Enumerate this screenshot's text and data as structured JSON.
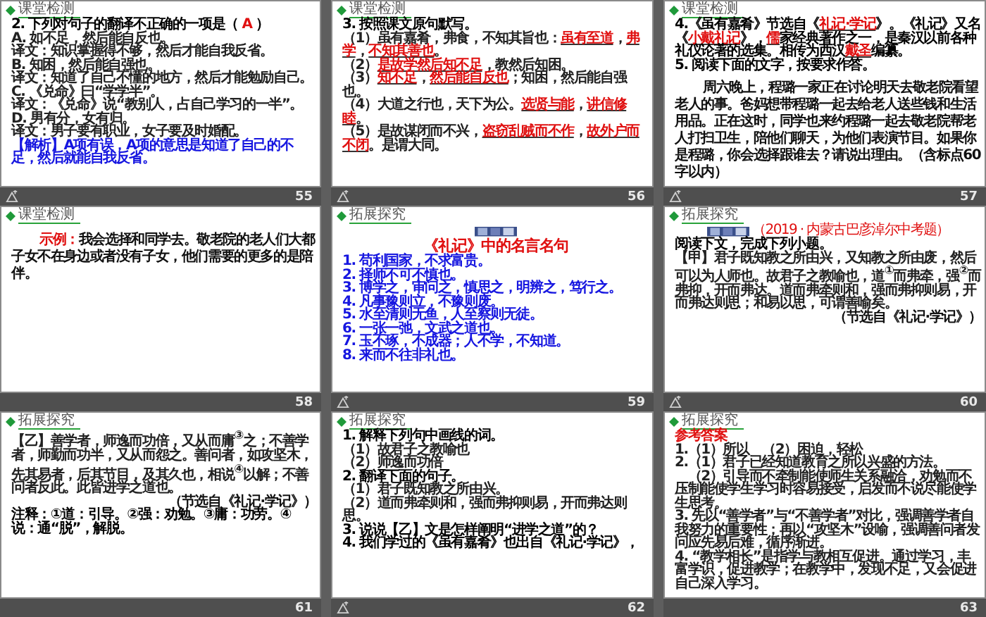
{
  "slides": [
    {
      "number": "55",
      "animated": true,
      "section": "课堂检测",
      "body": [
        {
          "kind": "question",
          "segments": [
            {
              "kind": "text",
              "text": "2. 下列对句子的翻译不正确的一项是（ "
            },
            {
              "kind": "answer",
              "text": "A"
            },
            {
              "kind": "text",
              "text": " ）"
            }
          ]
        },
        {
          "kind": "body",
          "text": "A. 如不足，然后能自反也。"
        },
        {
          "kind": "body",
          "text": "译文：知识掌握得不够，然后才能自我反省。"
        },
        {
          "kind": "body",
          "text": "B. 知困，然后能自强也。"
        },
        {
          "kind": "body",
          "text": "译文：知道了自己不懂的地方，然后才能勉励自己。"
        },
        {
          "kind": "body",
          "text": "C. 《兑命》曰“学学半”。"
        },
        {
          "kind": "body",
          "text": "译文：《兑命》说“教别人，占自己学习的一半”。"
        },
        {
          "kind": "body",
          "text": "D. 男有分，女有归。"
        },
        {
          "kind": "body",
          "text": "译文：男子要有职业，女子要及时婚配。"
        },
        {
          "kind": "blue",
          "text": "【解析】A项有误，A项的意思是知道了自己的不足，然后就能自我反省。"
        }
      ]
    },
    {
      "number": "56",
      "animated": true,
      "section": "课堂检测",
      "body": [
        {
          "kind": "question",
          "text": "3. 按照课文原句默写。"
        },
        {
          "kind": "body",
          "segments": [
            {
              "kind": "text",
              "text": "（1）虽有嘉肴，弗食，不知其旨也："
            },
            {
              "kind": "blank",
              "text": "虽有至道"
            },
            {
              "kind": "text",
              "text": "，"
            },
            {
              "kind": "blank",
              "text": "弗学"
            },
            {
              "kind": "text",
              "text": "，"
            },
            {
              "kind": "blank",
              "text": "不知其善也"
            },
            {
              "kind": "text",
              "text": "。"
            }
          ]
        },
        {
          "kind": "body",
          "segments": [
            {
              "kind": "text",
              "text": "（2）"
            },
            {
              "kind": "blank",
              "text": "是故学然后知不足"
            },
            {
              "kind": "text",
              "text": "，教然后知困。"
            }
          ]
        },
        {
          "kind": "body",
          "segments": [
            {
              "kind": "text",
              "text": "（3）"
            },
            {
              "kind": "blank",
              "text": "知不足"
            },
            {
              "kind": "text",
              "text": "，"
            },
            {
              "kind": "blank",
              "text": "然后能自反也"
            },
            {
              "kind": "text",
              "text": "；知困，然后能自强也。"
            }
          ]
        },
        {
          "kind": "body",
          "segments": [
            {
              "kind": "text",
              "text": "（4）大道之行也，天下为公。"
            },
            {
              "kind": "blank",
              "text": "选贤与能"
            },
            {
              "kind": "text",
              "text": "，"
            },
            {
              "kind": "blank",
              "text": "讲信修睦"
            },
            {
              "kind": "text",
              "text": "。"
            }
          ]
        },
        {
          "kind": "body",
          "segments": [
            {
              "kind": "text",
              "text": "（5）是故谋闭而不兴，"
            },
            {
              "kind": "blank",
              "text": "盗窃乱贼而不作"
            },
            {
              "kind": "text",
              "text": "，"
            },
            {
              "kind": "blank",
              "text": "故外户而不闭"
            },
            {
              "kind": "text",
              "text": "。是谓大同。"
            }
          ]
        }
      ]
    },
    {
      "number": "57",
      "animated": true,
      "section": "课堂检测",
      "body": [
        {
          "kind": "question",
          "segments": [
            {
              "kind": "text",
              "text": "4.《虽有嘉肴》节选自《"
            },
            {
              "kind": "blank",
              "text": "礼记·学记"
            },
            {
              "kind": "text",
              "text": "》。《礼记》又名《"
            },
            {
              "kind": "blank",
              "text": "小戴礼记"
            },
            {
              "kind": "text",
              "text": "》，"
            },
            {
              "kind": "blank",
              "text": "儒"
            },
            {
              "kind": "text",
              "text": "家经典著作之一，是秦汉以前各种礼仪论著的选集。相传为西汉"
            },
            {
              "kind": "blank",
              "text": "戴圣"
            },
            {
              "kind": "text",
              "text": "编纂。"
            }
          ]
        },
        {
          "kind": "question",
          "text": "5. 阅读下面的文字，按要求作答。"
        },
        {
          "kind": "indent",
          "text": "周六晚上，程璐一家正在讨论明天去敬老院看望老人的事。爸妈想带程璐一起去给老人送些钱和生活用品。正在这时，同学也来约程璐一起去敬老院帮老人打扫卫生，陪他们聊天，为他们表演节目。如果你是程璐，你会选择跟谁去？请说出理由。（含标点60字以内）"
        }
      ]
    },
    {
      "number": "58",
      "animated": false,
      "section": "课堂检测",
      "body": [
        {
          "kind": "indent",
          "segments": [
            {
              "kind": "answer",
              "text": "示例："
            },
            {
              "kind": "text",
              "text": "我会选择和同学去。敬老院的老人们大都子女不在身边或者没有子女，他们需要的更多的是陪伴。"
            }
          ]
        }
      ]
    },
    {
      "number": "59",
      "animated": true,
      "section": "拓展探究",
      "body": [
        {
          "kind": "banner"
        },
        {
          "kind": "title",
          "text": "《礼记》中的名言名句"
        },
        {
          "kind": "blue",
          "text": "1. 苟利国家，不求富贵。"
        },
        {
          "kind": "blue",
          "text": "2. 择师不可不慎也。"
        },
        {
          "kind": "blue",
          "text": "3. 博学之，审问之，慎思之，明辨之，笃行之。"
        },
        {
          "kind": "blue",
          "text": "4. 凡事豫则立，不豫则废。"
        },
        {
          "kind": "blue",
          "text": "5. 水至清则无鱼，人至察则无徒。"
        },
        {
          "kind": "blue",
          "text": "6. 一张一弛，文武之道也。"
        },
        {
          "kind": "blue",
          "text": "7. 玉不琢，不成器；人不学，不知道。"
        },
        {
          "kind": "blue",
          "text": "8. 来而不往非礼也。"
        }
      ]
    },
    {
      "number": "60",
      "animated": true,
      "section": "拓展探究",
      "body": [
        {
          "kind": "banner",
          "text": "（2019 · 内蒙古巴彦淖尔中考题）"
        },
        {
          "kind": "question",
          "text": "阅读下文，完成下列小题。"
        },
        {
          "kind": "body",
          "text": "【甲】君子既知教之所由兴，又知教之所由废，然后可以为人师也。故君子之教喻也，道$^{①}$而弗牵，强$^{②}$而弗抑，开而弗达。道而弗牵则和，强而弗抑则易，开而弗达则思；和易以思，可谓善喻矣。"
        },
        {
          "kind": "source",
          "text": "（节选自《礼记·学记》）"
        }
      ]
    },
    {
      "number": "61",
      "animated": false,
      "section": "拓展探究",
      "body": [
        {
          "kind": "body",
          "text": "【乙】善学者，师逸而功倍，又从而庸$^{③}$之；不善学者，师勤而功半，又从而怨之。善问者，如攻坚木，先其易者，后其节目，及其久也，相说$^{④}$以解；不善问者反此。此皆进学之道也。"
        },
        {
          "kind": "source",
          "text": "（节选自《礼记·学记》）"
        },
        {
          "kind": "question",
          "text": "注释：①道：引导。②强：劝勉。③庸：功劳。④说：通“脱”，解脱。"
        }
      ]
    },
    {
      "number": "62",
      "animated": true,
      "section": "拓展探究",
      "body": [
        {
          "kind": "question",
          "text": "1. 解释下列句中画线的词。"
        },
        {
          "kind": "body",
          "text": "（1）故君子之教喻也"
        },
        {
          "kind": "body",
          "text": "（2）师逸而功倍"
        },
        {
          "kind": "question",
          "text": "2. 翻译下面的句子。"
        },
        {
          "kind": "body",
          "text": "（1）君子既知教之所由兴。"
        },
        {
          "kind": "body",
          "text": "（2）道而弗牵则和，强而弗抑则易，开而弗达则思。"
        },
        {
          "kind": "question",
          "text": "3. 说说【乙】文是怎样阐明“进学之道”的？"
        },
        {
          "kind": "question",
          "text": "4. 我们学过的《虽有嘉肴》也出自《礼记·学记》，"
        }
      ]
    },
    {
      "number": "63",
      "animated": false,
      "section": "拓展探究",
      "body": [
        {
          "kind": "label",
          "text": "参考答案"
        },
        {
          "kind": "body",
          "text": "1.（1）所以　（2）困迫，轻松"
        },
        {
          "kind": "body",
          "text": "2.（1）君子已经知道教育之所以兴盛的方法。"
        },
        {
          "kind": "body",
          "text": "　（2）引导而不牵制能使师生关系融洽，劝勉而不压制能使学生学习时容易接受，启发而不说尽能使学生思考。"
        },
        {
          "kind": "body",
          "text": "3. 先以“善学者”与“不善学者”对比，强调善学者自我努力的重要性；再以“攻坚木”设喻，强调善问者发问应先易后难，循序渐进。"
        },
        {
          "kind": "body",
          "text": "4. “教学相长”是指学与教相互促进。通过学习，丰富学识，促进教学；在教学中，发现不足，又会促进自己深入学习。"
        }
      ]
    }
  ]
}
